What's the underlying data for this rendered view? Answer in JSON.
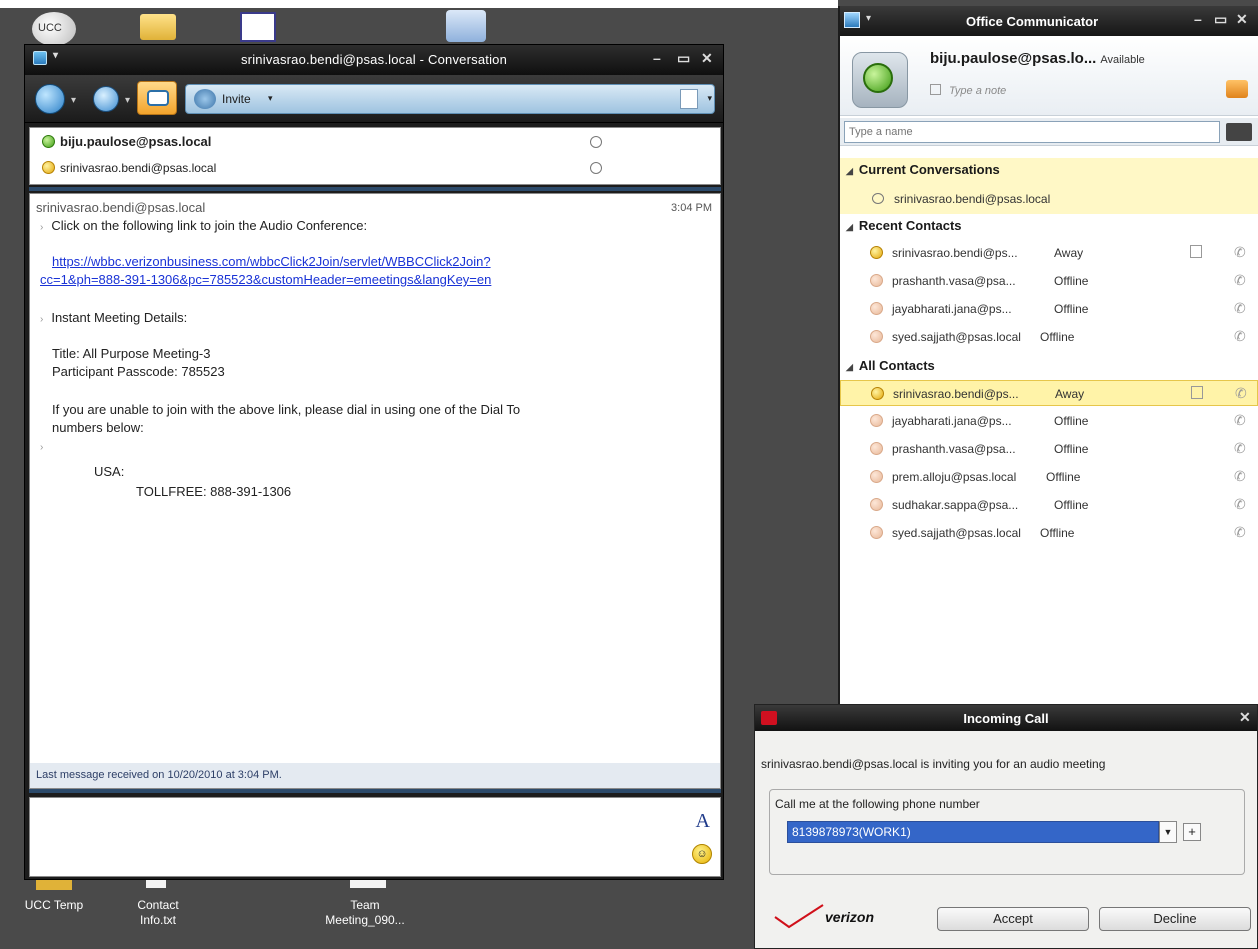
{
  "desktop": {
    "top_icon_label": "UCC",
    "icons": [
      {
        "label": "UCC Temp"
      },
      {
        "label": "Contact\nInfo.txt"
      },
      {
        "label": "Team\nMeeting_090..."
      }
    ]
  },
  "conversation": {
    "title": "srinivasrao.bendi@psas.local - Conversation",
    "toolbar": {
      "invite_label": "Invite"
    },
    "participants": [
      {
        "name": "biju.paulose@psas.local",
        "presence": "available"
      },
      {
        "name": "srinivasrao.bendi@psas.local",
        "presence": "away"
      }
    ],
    "history": {
      "sender": "srinivasrao.bendi@psas.local",
      "time": "3:04 PM",
      "line1": "Click on the following link to join the Audio Conference:",
      "link_line1": "https://wbbc.verizonbusiness.com/wbbcClick2Join/servlet/WBBCClick2Join?",
      "link_line2": "cc=1&ph=888-391-1306&pc=785523&customHeader=emeetings&langKey=en",
      "details_heading": "Instant Meeting Details:",
      "title_line": "Title: All Purpose Meeting-3",
      "passcode_line": "Participant Passcode: 785523",
      "dial_line1": "If you are unable to join with the above link, please dial in using one of the Dial To",
      "dial_line2": "numbers below:",
      "country": "USA:",
      "tollfree": "TOLLFREE: 888-391-1306"
    },
    "status_text": "Last message received on 10/20/2010 at 3:04 PM."
  },
  "communicator": {
    "title": "Office Communicator",
    "user": "biju.paulose@psas.lo...",
    "user_status": "Available",
    "note_placeholder": "Type a note",
    "search_placeholder": "Type a name",
    "groups": {
      "current": {
        "label": "Current Conversations",
        "items": [
          {
            "name": "srinivasrao.bendi@psas.local"
          }
        ]
      },
      "recent": {
        "label": "Recent Contacts",
        "items": [
          {
            "name": "srinivasrao.bendi@ps...",
            "status": "Away"
          },
          {
            "name": "prashanth.vasa@psa...",
            "status": "Offline"
          },
          {
            "name": "jayabharati.jana@ps...",
            "status": "Offline"
          },
          {
            "name": "syed.sajjath@psas.local",
            "status": "Offline"
          }
        ]
      },
      "all": {
        "label": "All Contacts",
        "items": [
          {
            "name": "srinivasrao.bendi@ps...",
            "status": "Away"
          },
          {
            "name": "jayabharati.jana@ps...",
            "status": "Offline"
          },
          {
            "name": "prashanth.vasa@psa...",
            "status": "Offline"
          },
          {
            "name": "prem.alloju@psas.local",
            "status": "Offline"
          },
          {
            "name": "sudhakar.sappa@psa...",
            "status": "Offline"
          },
          {
            "name": "syed.sajjath@psas.local",
            "status": "Offline"
          }
        ]
      }
    }
  },
  "incoming_call": {
    "title": "Incoming Call",
    "message": "srinivasrao.bendi@psas.local is inviting you for an audio meeting",
    "group_label": "Call me at the following phone number",
    "selected_number": "8139878973(WORK1)",
    "brand": "verizon",
    "accept_label": "Accept",
    "decline_label": "Decline"
  },
  "colors": {
    "link": "#1a33d6",
    "selection_blue": "#3466c8",
    "highlight_yellow": "#fff3a8"
  }
}
